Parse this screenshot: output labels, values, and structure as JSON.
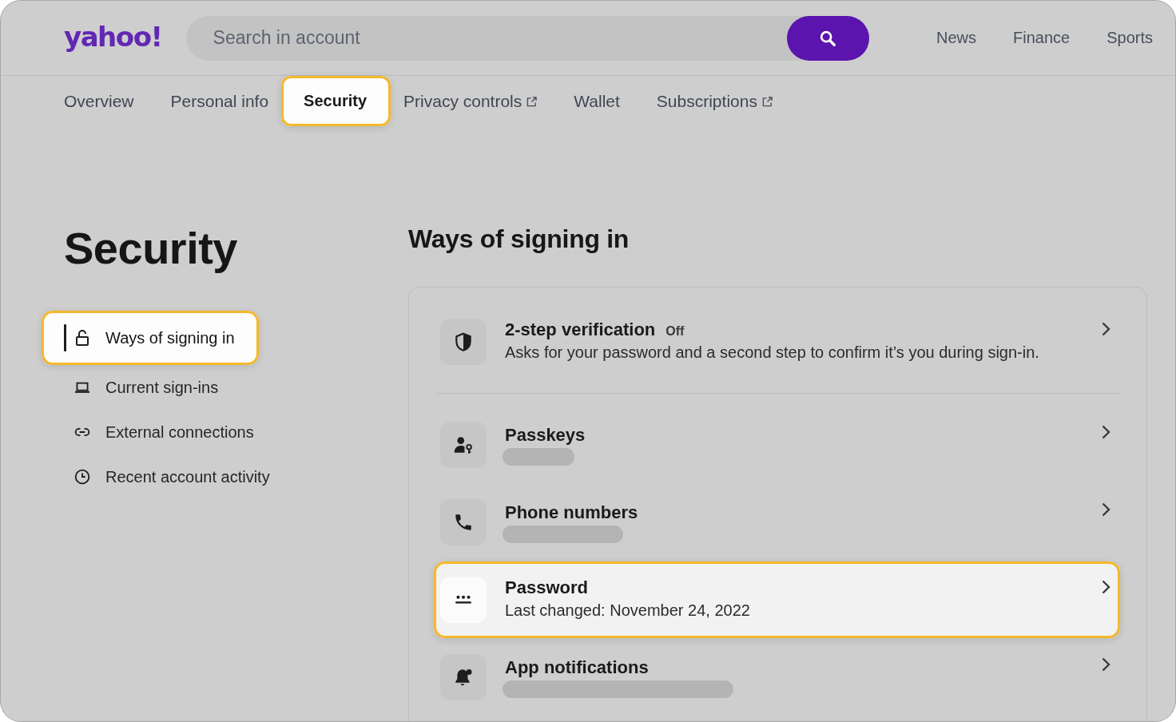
{
  "header": {
    "logo": "yahoo!",
    "search": {
      "placeholder": "Search in account"
    },
    "nav_links": [
      "News",
      "Finance",
      "Sports"
    ]
  },
  "tabs": [
    {
      "label": "Overview",
      "selected": false,
      "external": false
    },
    {
      "label": "Personal info",
      "selected": false,
      "external": false
    },
    {
      "label": "Security",
      "selected": true,
      "external": false
    },
    {
      "label": "Privacy controls",
      "selected": false,
      "external": true
    },
    {
      "label": "Wallet",
      "selected": false,
      "external": false
    },
    {
      "label": "Subscriptions",
      "selected": false,
      "external": true
    }
  ],
  "page_title": "Security",
  "sidebar": {
    "items": [
      {
        "label": "Ways of signing in",
        "selected": true
      },
      {
        "label": "Current sign-ins",
        "selected": false
      },
      {
        "label": "External connections",
        "selected": false
      },
      {
        "label": "Recent account activity",
        "selected": false
      }
    ]
  },
  "section": {
    "title": "Ways of signing in",
    "groups": [
      {
        "rows": [
          {
            "title": "2-step verification",
            "status": "Off",
            "description": "Asks for your password and a second step to confirm it’s you during sign-in.",
            "loading": false,
            "highlighted": false
          }
        ]
      },
      {
        "rows": [
          {
            "title": "Passkeys",
            "loading": true,
            "highlighted": false
          },
          {
            "title": "Phone numbers",
            "loading": true,
            "highlighted": false
          },
          {
            "title": "Password",
            "description": "Last changed: November 24, 2022",
            "loading": false,
            "highlighted": true
          },
          {
            "title": "App notifications",
            "loading": true,
            "highlighted": false
          }
        ]
      }
    ]
  }
}
